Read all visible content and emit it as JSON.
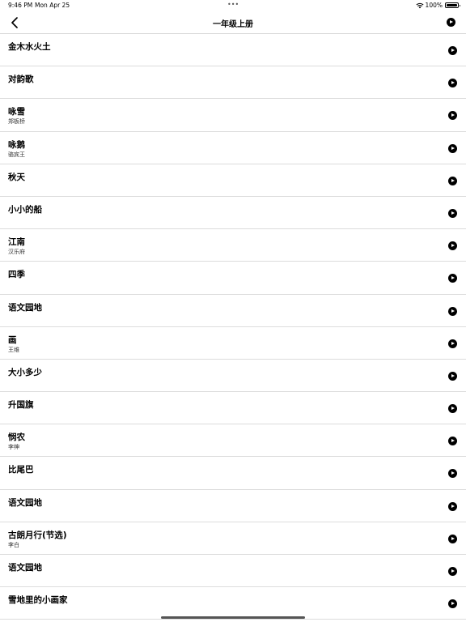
{
  "status_bar": {
    "time": "9:46 PM",
    "date": "Mon Apr 25",
    "dots": "•••",
    "battery": "100%"
  },
  "nav": {
    "title": "一年级上册"
  },
  "poems": [
    {
      "title": "金木水火土",
      "author": ""
    },
    {
      "title": "对韵歌",
      "author": ""
    },
    {
      "title": "咏雪",
      "author": "郑板桥"
    },
    {
      "title": "咏鹅",
      "author": "骆宾王"
    },
    {
      "title": "秋天",
      "author": ""
    },
    {
      "title": "小小的船",
      "author": ""
    },
    {
      "title": "江南",
      "author": "汉乐府"
    },
    {
      "title": "四季",
      "author": ""
    },
    {
      "title": "语文园地",
      "author": ""
    },
    {
      "title": "画",
      "author": "王维"
    },
    {
      "title": "大小多少",
      "author": ""
    },
    {
      "title": "升国旗",
      "author": ""
    },
    {
      "title": "悯农",
      "author": "李绅"
    },
    {
      "title": "比尾巴",
      "author": ""
    },
    {
      "title": "语文园地",
      "author": ""
    },
    {
      "title": "古朗月行(节选)",
      "author": "李白"
    },
    {
      "title": "语文园地",
      "author": ""
    },
    {
      "title": "雪地里的小画家",
      "author": ""
    }
  ]
}
